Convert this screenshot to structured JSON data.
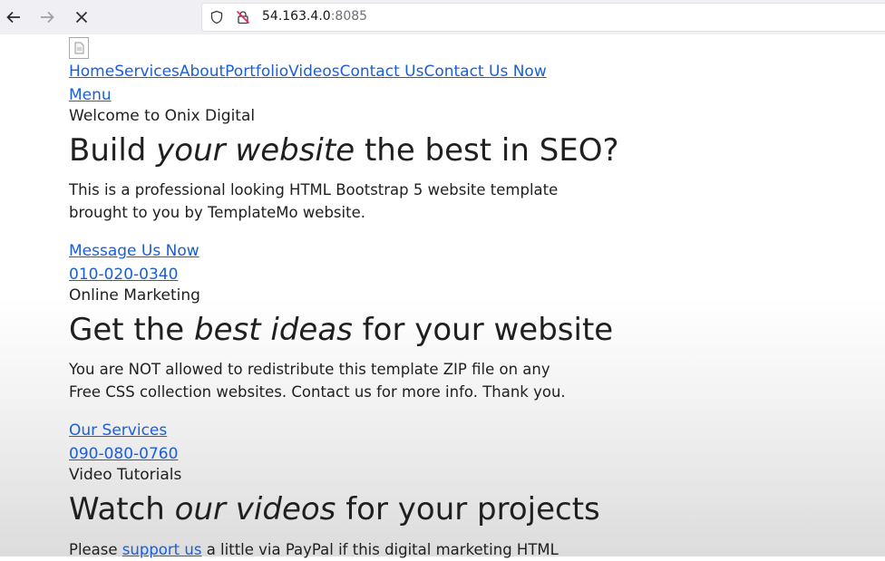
{
  "browser": {
    "url_host": "54.163.4.0",
    "url_port": ":8085"
  },
  "nav": {
    "items": [
      "Home",
      "Services",
      "About",
      "Portfolio",
      "Videos",
      "Contact Us",
      "Contact Us Now"
    ],
    "menu_label": "Menu"
  },
  "sections": [
    {
      "eyebrow": "Welcome to Onix Digital",
      "heading_pre": "Build ",
      "heading_em": "your website",
      "heading_post": " the best in SEO?",
      "body": "This is a professional looking HTML Bootstrap 5 website template brought to you by TemplateMo website.",
      "link1": "Message Us Now",
      "link2": "010-020-0340"
    },
    {
      "eyebrow": "Online Marketing",
      "heading_pre": "Get the ",
      "heading_em": "best ideas",
      "heading_post": " for your website",
      "body": "You are NOT allowed to redistribute this template ZIP file on any Free CSS collection websites. Contact us for more info. Thank you.",
      "link1": "Our Services",
      "link2": "090-080-0760"
    },
    {
      "eyebrow": "Video Tutorials",
      "heading_pre": "Watch ",
      "heading_em": "our videos",
      "heading_post": " for your projects",
      "body_pre": "Please ",
      "body_link": "support us",
      "body_post": " a little via PayPal if this digital marketing HTML"
    }
  ]
}
